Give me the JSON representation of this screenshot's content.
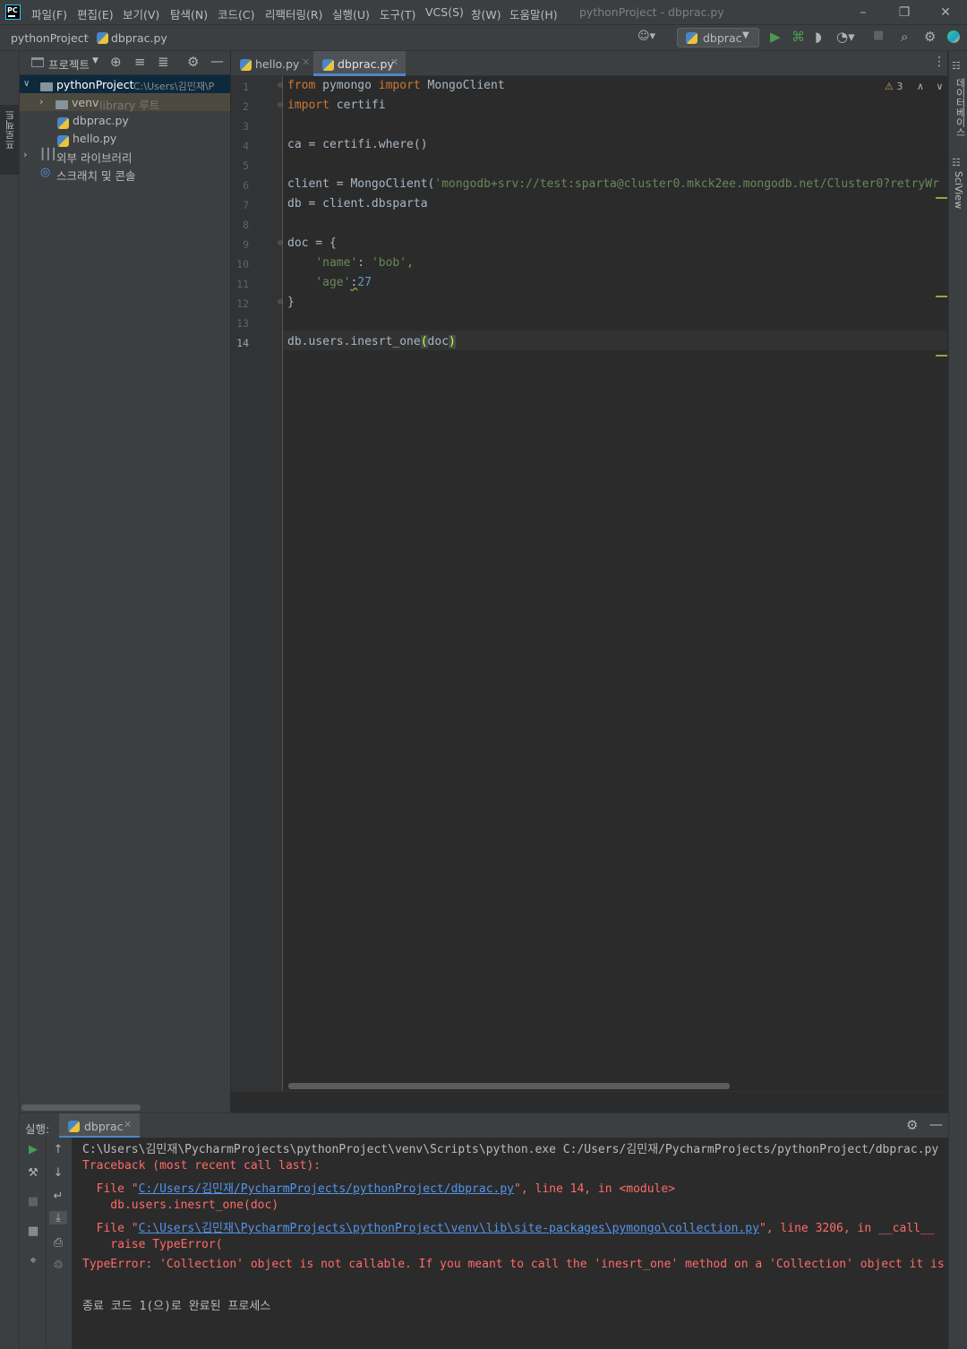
{
  "app": {
    "logo": "PC",
    "window_title": "pythonProject - dbprac.py"
  },
  "menu": [
    "파일(F)",
    "편집(E)",
    "보기(V)",
    "탐색(N)",
    "코드(C)",
    "리팩터링(R)",
    "실행(U)",
    "도구(T)",
    "VCS(S)",
    "창(W)",
    "도움말(H)"
  ],
  "breadcrumb": {
    "project": "pythonProject",
    "file": "dbprac.py"
  },
  "toolbar": {
    "run_config": "dbprac"
  },
  "left_strip": {
    "project_tab": "프로젝트"
  },
  "project_panel": {
    "title": "프로젝트",
    "tree": [
      {
        "label": "pythonProject",
        "hint": "C:\\Users\\김민재\\P",
        "type": "folder",
        "expanded": true
      },
      {
        "label": "venv",
        "hint": "library 루트",
        "type": "folder",
        "expanded": false
      },
      {
        "label": "dbprac.py",
        "hint": "",
        "type": "python"
      },
      {
        "label": "hello.py",
        "hint": "",
        "type": "python"
      },
      {
        "label": "외부 라이브러리",
        "hint": "",
        "type": "library"
      },
      {
        "label": "스크래치 및 콘솔",
        "hint": "",
        "type": "scratch"
      }
    ]
  },
  "editor": {
    "tabs": [
      {
        "label": "hello.py",
        "active": false
      },
      {
        "label": "dbprac.py",
        "active": true
      }
    ],
    "warning_count": "3",
    "line_numbers": [
      "1",
      "2",
      "3",
      "4",
      "5",
      "6",
      "7",
      "8",
      "9",
      "10",
      "11",
      "12",
      "13",
      "14"
    ],
    "current_line": "14",
    "code": {
      "l1_kw1": "from",
      "l1_mod": " pymongo ",
      "l1_kw2": "import",
      "l1_name": " MongoClient",
      "l2_kw": "import",
      "l2_mod": " certifi",
      "l4": "ca = certifi.where()",
      "l6_a": "client = MongoClient(",
      "l6_str": "'mongodb+srv://test:sparta@cluster0.mkck2ee.mongodb.net/Cluster0?retryWr",
      "l7": "db = client.dbsparta",
      "l9": "doc = {",
      "l10_indent": "    ",
      "l10_key": "'name'",
      "l10_sep": ": ",
      "l10_val": "'bob'",
      "l10_end": ",",
      "l11_indent": "    ",
      "l11_key": "'age'",
      "l11_sep": ":",
      "l11_val": "27",
      "l12": "}",
      "l14_a": "db.users.inesrt_one",
      "l14_p1": "(",
      "l14_arg": "doc",
      "l14_p2": ")"
    }
  },
  "right_strip": {
    "database": "데이터베이스",
    "sciview": "SciView"
  },
  "run": {
    "label": "실행:",
    "tab": "dbprac",
    "console": {
      "cmd": "C:\\Users\\김민재\\PycharmProjects\\pythonProject\\venv\\Scripts\\python.exe C:/Users/김민재/PycharmProjects/pythonProject/dbprac.py",
      "traceback": "Traceback (most recent call last):",
      "f1_pre": "  File \"",
      "f1_link": "C:/Users/김민재/PycharmProjects/pythonProject/dbprac.py",
      "f1_post": "\", line 14, in <module>",
      "f1_code": "    db.users.inesrt_one(doc)",
      "f2_pre": "  File \"",
      "f2_link": "C:\\Users\\김민재\\PycharmProjects\\pythonProject\\venv\\lib\\site-packages\\pymongo\\collection.py",
      "f2_post": "\", line 3206, in __call__",
      "f2_code": "    raise TypeError(",
      "error": "TypeError: 'Collection' object is not callable. If you meant to call the 'inesrt_one' method on a 'Collection' object it is failing",
      "exit": "종료 코드 1(으)로 완료된 프로세스"
    }
  },
  "colors": {
    "keyword": "#cc7832",
    "string": "#6a8759",
    "number": "#6897bb",
    "error": "#ff6b68",
    "link": "#5394ec",
    "run_green": "#499c54"
  }
}
